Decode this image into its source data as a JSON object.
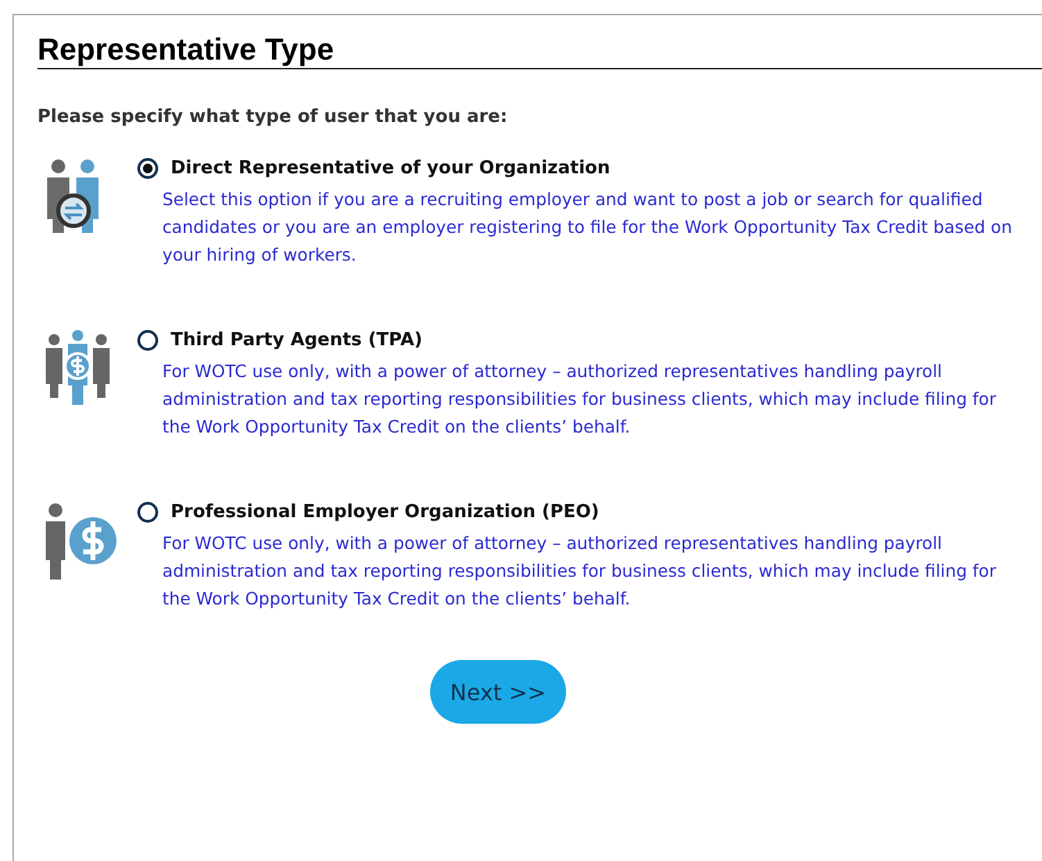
{
  "title": "Representative Type",
  "prompt": "Please specify what type of user that you are:",
  "options": [
    {
      "kind": "exchange",
      "label": "Direct Representative of your Organization",
      "selected": true,
      "description": "Select this option if you are a recruiting employer and want to post a job or search for qualified candidates or you are an employer registering to file for the Work Opportunity Tax Credit based on your hiring of workers."
    },
    {
      "kind": "group-dollar",
      "label": "Third Party Agents (TPA)",
      "selected": false,
      "description": "For WOTC use only, with a power of attorney – authorized representatives handling payroll administration and tax reporting responsibilities for business clients, which may include filing for the Work Opportunity Tax Credit on the clients’ behalf."
    },
    {
      "kind": "person-dollar",
      "label": "Professional Employer Organization (PEO)",
      "selected": false,
      "description": "For WOTC use only, with a power of attorney – authorized representatives handling payroll administration and tax reporting responsibilities for business clients, which may include filing for the Work Opportunity Tax Credit on the clients’ behalf."
    }
  ],
  "next_button": "Next >>"
}
